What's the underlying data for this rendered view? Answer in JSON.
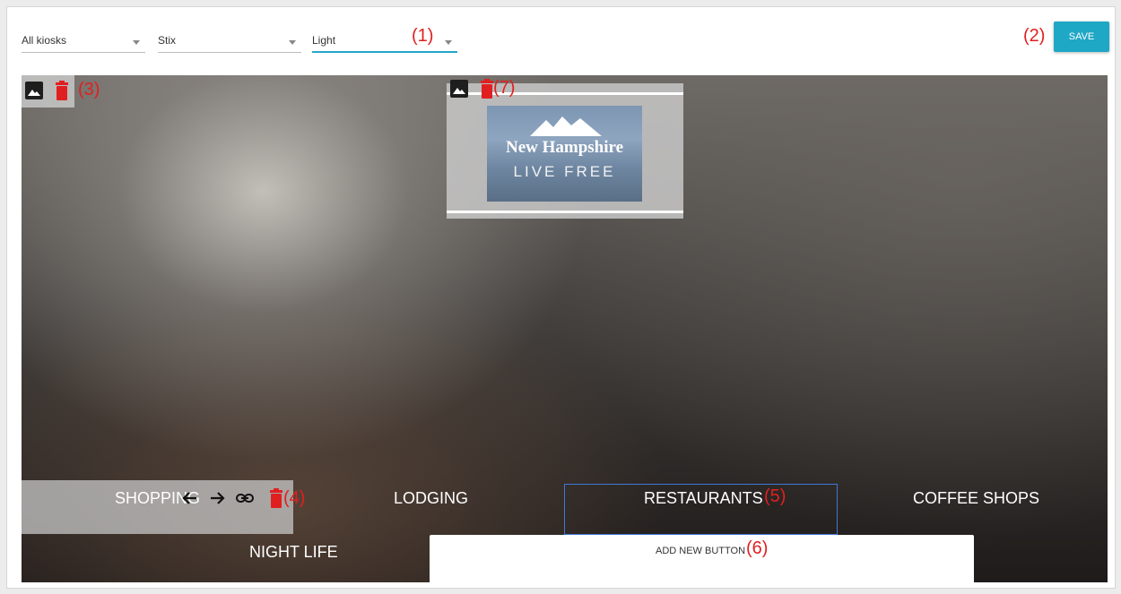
{
  "toolbar": {
    "kiosk_select": {
      "value": "All kiosks"
    },
    "font_select": {
      "value": "Stix"
    },
    "theme_select": {
      "value": "Light"
    },
    "save_label": "SAVE"
  },
  "annotations": {
    "a1": "(1)",
    "a2": "(2)",
    "a3": "(3)",
    "a4": "(4)",
    "a5": "(5)",
    "a6": "(6)",
    "a7": "(7)"
  },
  "logo": {
    "title": "New Hampshire",
    "subtitle": "LIVE FREE"
  },
  "nav_buttons": {
    "shopping": "SHOPPING",
    "lodging": "LODGING",
    "restaurants": "RESTAURANTS",
    "coffee_shops": "COFFEE SHOPS",
    "night_life": "NIGHT LIFE"
  },
  "add_button_label": "ADD NEW BUTTON",
  "icons": {
    "background_image": "image-icon",
    "background_delete": "trash-icon",
    "logo_image": "image-icon",
    "logo_delete": "trash-icon",
    "move_left": "arrow-left-icon",
    "move_right": "arrow-right-icon",
    "link": "link-icon",
    "button_delete": "trash-icon"
  },
  "colors": {
    "accent": "#1fa7c6",
    "annotation": "#e02020",
    "delete": "#e02020",
    "selection_border": "#3f78d8"
  }
}
